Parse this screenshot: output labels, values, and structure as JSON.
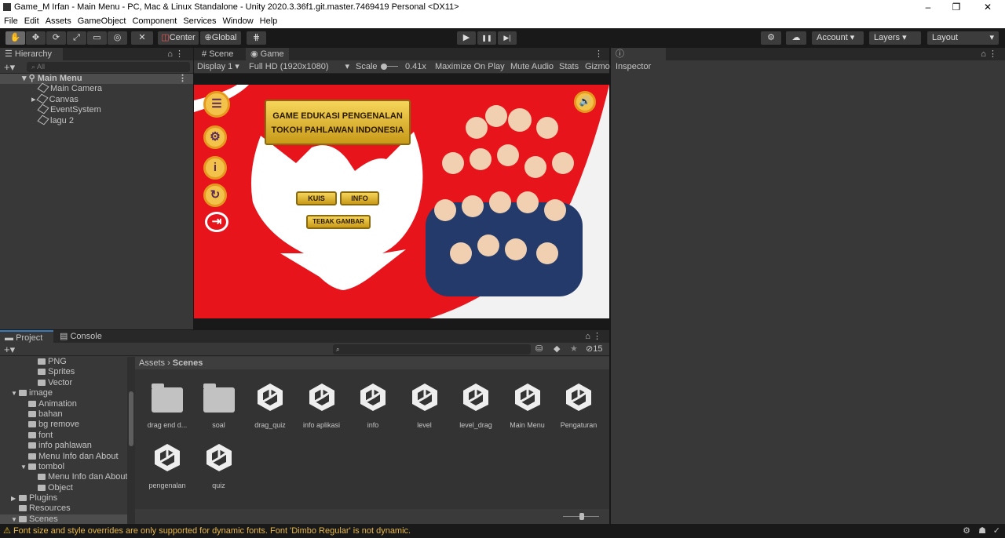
{
  "window": {
    "title": "Game_M Irfan - Main Menu - PC, Mac & Linux Standalone - Unity 2020.3.36f1.git.master.7469419 Personal <DX11>",
    "controls": [
      "–",
      "❐",
      "✕"
    ]
  },
  "menu": [
    "File",
    "Edit",
    "Assets",
    "GameObject",
    "Component",
    "Services",
    "Window",
    "Help"
  ],
  "toolbar": {
    "center": "Center",
    "global": "Global",
    "account": "Account",
    "layers": "Layers",
    "layout": "Layout",
    "play": "▶",
    "pause": "❚❚",
    "step": "▶|"
  },
  "hierarchy": {
    "title": "Hierarchy",
    "search_placeholder": "All",
    "scene": "Main Menu",
    "items": [
      "Main Camera",
      "Canvas",
      "EventSystem",
      "lagu 2"
    ]
  },
  "game": {
    "tabs": [
      "Scene",
      "Game"
    ],
    "display": "Display 1",
    "resolution": "Full HD (1920x1080)",
    "scale_label": "Scale",
    "scale_value": "0.41x",
    "maximize": "Maximize On Play",
    "mute": "Mute Audio",
    "stats": "Stats",
    "gizmos": "Gizmo",
    "title_line1": "GAME EDUKASI PENGENALAN",
    "title_line2": "TOKOH PAHLAWAN INDONESIA",
    "btn_kuis": "KUIS",
    "btn_info": "INFO",
    "btn_tebak": "TEBAK GAMBAR",
    "colors": {
      "bg": "#e8141c",
      "gold": "#f3c24a"
    }
  },
  "inspector": {
    "title": "Inspector"
  },
  "project": {
    "tabs": [
      "Project",
      "Console"
    ],
    "hidden_count": "15",
    "breadcrumb": [
      "Assets",
      "Scenes"
    ],
    "tree": [
      {
        "label": "PNG",
        "indent": 3
      },
      {
        "label": "Sprites",
        "indent": 3
      },
      {
        "label": "Vector",
        "indent": 3
      },
      {
        "label": "image",
        "indent": 1,
        "open": true
      },
      {
        "label": "Animation",
        "indent": 2
      },
      {
        "label": "bahan",
        "indent": 2
      },
      {
        "label": "bg remove",
        "indent": 2
      },
      {
        "label": "font",
        "indent": 2
      },
      {
        "label": "info pahlawan",
        "indent": 2
      },
      {
        "label": "Menu Info dan About",
        "indent": 2
      },
      {
        "label": "tombol",
        "indent": 2,
        "open": true
      },
      {
        "label": "Menu Info dan About",
        "indent": 3
      },
      {
        "label": "Object",
        "indent": 3
      },
      {
        "label": "Plugins",
        "indent": 1,
        "closed": true
      },
      {
        "label": "Resources",
        "indent": 1
      },
      {
        "label": "Scenes",
        "indent": 1,
        "open": true,
        "selected": true
      }
    ],
    "assets": [
      {
        "name": "drag end d...",
        "type": "folder"
      },
      {
        "name": "soal",
        "type": "folder"
      },
      {
        "name": "drag_quiz",
        "type": "scene"
      },
      {
        "name": "info aplikasi",
        "type": "scene"
      },
      {
        "name": "info",
        "type": "scene"
      },
      {
        "name": "level",
        "type": "scene"
      },
      {
        "name": "level_drag",
        "type": "scene"
      },
      {
        "name": "Main Menu",
        "type": "scene"
      },
      {
        "name": "Pengaturan",
        "type": "scene"
      },
      {
        "name": "pengenalan",
        "type": "scene"
      },
      {
        "name": "quiz",
        "type": "scene"
      }
    ]
  },
  "status": {
    "message": "Font size and style overrides are only supported for dynamic fonts. Font 'Dimbo Regular' is not dynamic.",
    "color": "#e8b84a"
  }
}
